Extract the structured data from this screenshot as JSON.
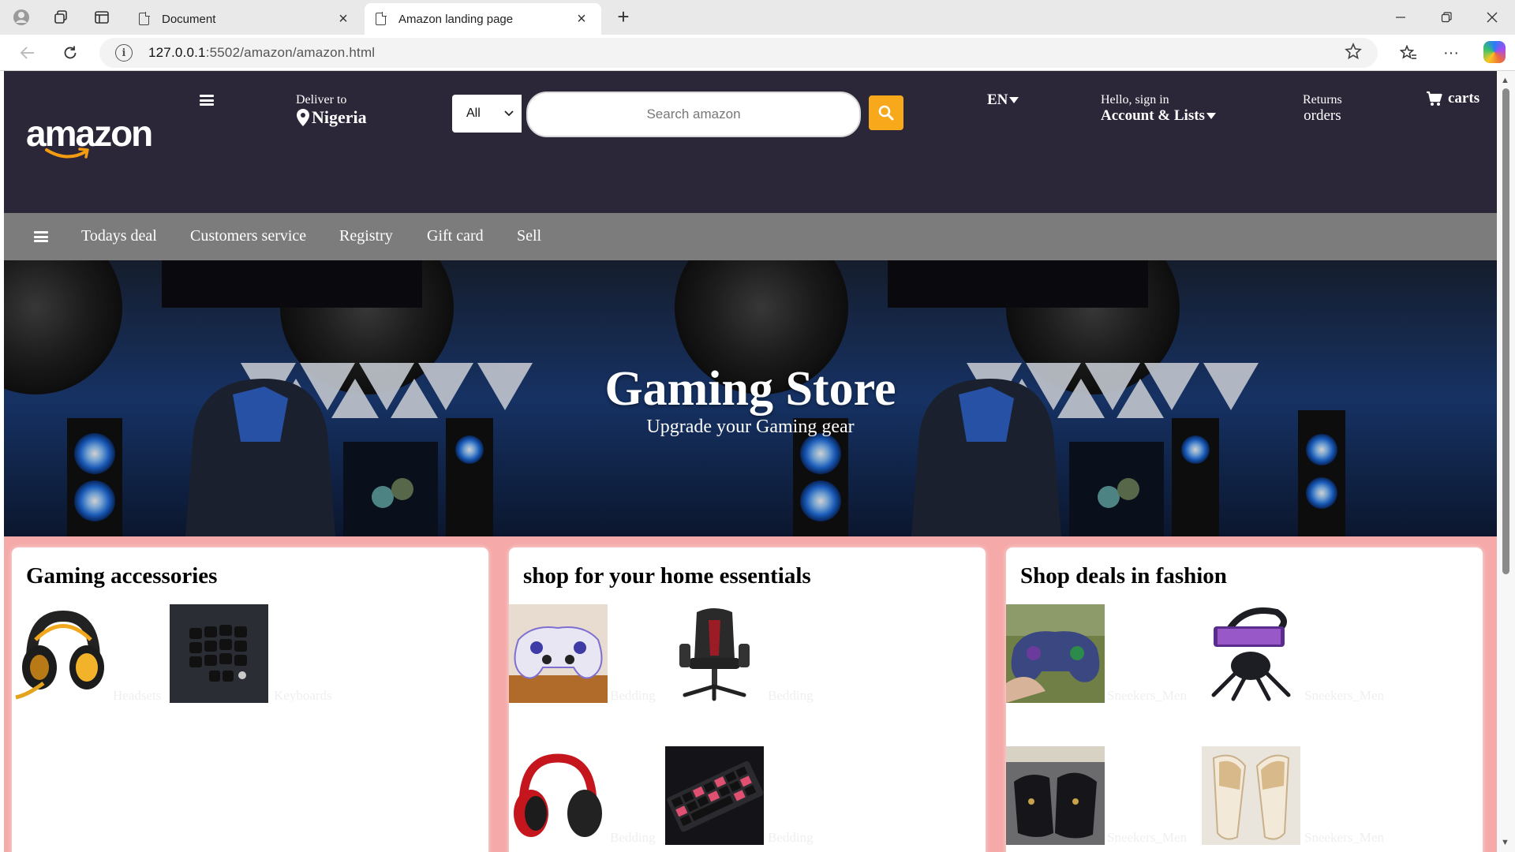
{
  "browser": {
    "tabs": [
      {
        "title": "Document",
        "active": false
      },
      {
        "title": "Amazon landing page",
        "active": true
      }
    ],
    "url_host": "127.0.0.1",
    "url_rest": ":5502/amazon/amazon.html"
  },
  "header": {
    "logo_text": "amazon",
    "deliver_label": "Deliver to",
    "deliver_location": "Nigeria",
    "search_category": "All",
    "search_placeholder": "Search amazon",
    "language": "EN",
    "greeting": "Hello, sign in",
    "account_label": "Account & Lists",
    "returns_label": "Returns",
    "orders_label": "orders",
    "cart_label": "carts"
  },
  "subnav": {
    "items": [
      "Todays deal",
      "Customers service",
      "Registry",
      "Gift card",
      "Sell"
    ]
  },
  "hero": {
    "title": "Gaming Store",
    "subtitle": "Upgrade your Gaming gear"
  },
  "cards": [
    {
      "title": "Gaming accessories",
      "products": [
        {
          "caption": "Headsets",
          "icon": "headset-image"
        },
        {
          "caption": "Keyboards",
          "icon": "keypad-image"
        }
      ]
    },
    {
      "title": "shop for your home essentials",
      "products": [
        {
          "caption": "Bedding",
          "icon": "controller-image"
        },
        {
          "caption": "Bedding",
          "icon": "gaming-chair-image"
        },
        {
          "caption": "Bedding",
          "icon": "headphones-image"
        },
        {
          "caption": "Bedding",
          "icon": "keyboard-image"
        }
      ]
    },
    {
      "title": "Shop deals in fashion",
      "products": [
        {
          "caption": "Sneekers_Men",
          "icon": "controller-image"
        },
        {
          "caption": "Sneekers_Men",
          "icon": "gaming-cockpit-image"
        },
        {
          "caption": "Sneekers_Men",
          "icon": "loafers-image"
        },
        {
          "caption": "Sneekers_Men",
          "icon": "slippers-image"
        }
      ]
    }
  ],
  "colors": {
    "header_bg": "#2b2638",
    "subnav_bg": "#7c7c7c",
    "search_button": "#f7a91b",
    "cards_bg": "#f5aaa9"
  }
}
